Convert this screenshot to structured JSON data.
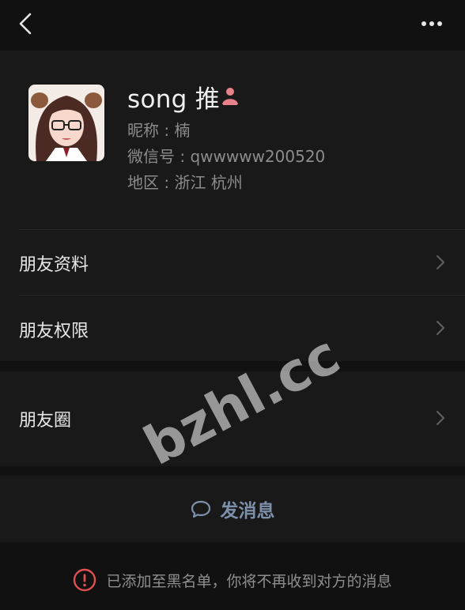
{
  "profile": {
    "name": "song 推",
    "nickname": "昵称 : 楠",
    "wechat_id": "微信号 : qwwwww200520",
    "region": "地区 : 浙江  杭州"
  },
  "menu": {
    "friend_info": "朋友资料",
    "friend_permission": "朋友权限",
    "moments": "朋友圈"
  },
  "actions": {
    "send_message": "发消息"
  },
  "notice": {
    "blacklist_text": "已添加至黑名单，你将不再收到对方的消息"
  },
  "watermark": {
    "text": "bzhl.cc"
  },
  "icons": {
    "back": "chevron-left-icon",
    "more": "ellipsis-icon",
    "gender": "female-user-icon",
    "chat": "chat-bubble-icon",
    "warning": "exclamation-circle-icon"
  },
  "colors": {
    "background": "#111111",
    "card": "#191919",
    "link_blue": "#7d90aa",
    "alert_red": "#e05050",
    "gender_pink": "#e8828a"
  }
}
